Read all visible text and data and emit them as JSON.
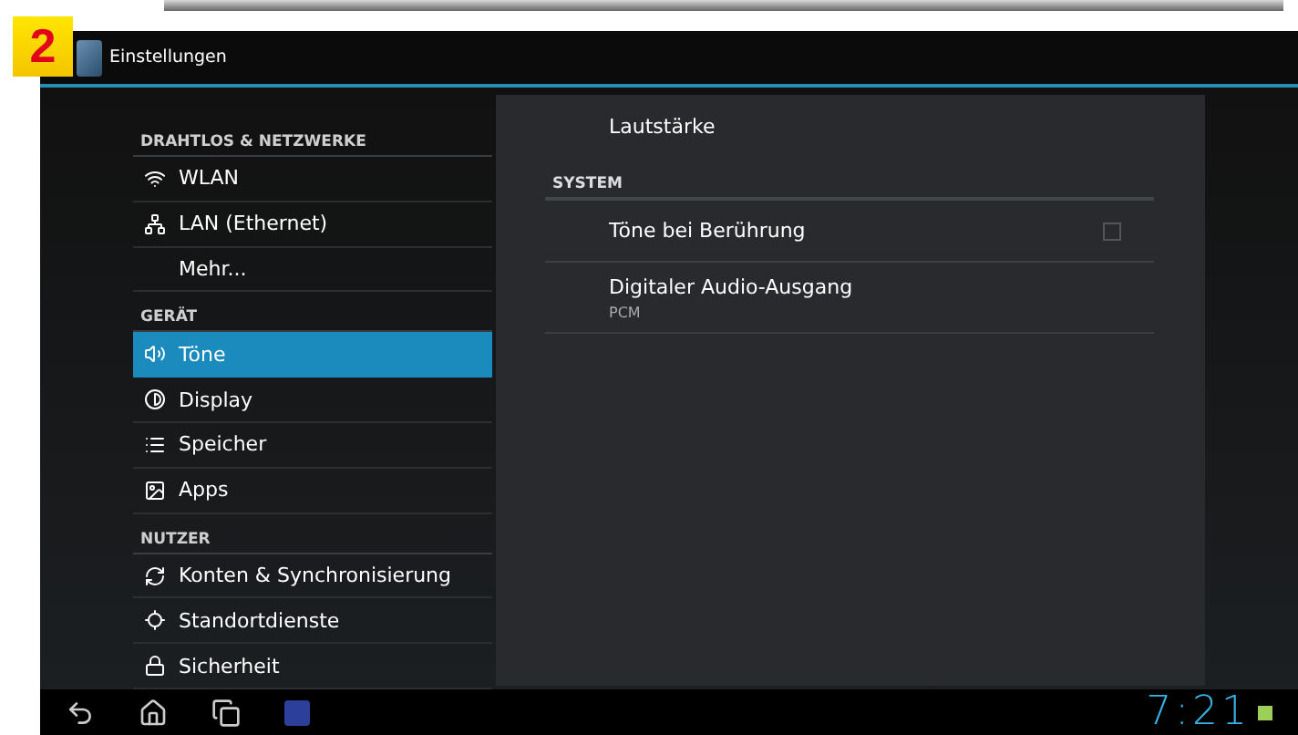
{
  "badge": "2",
  "window": {
    "title": "Einstellungen"
  },
  "sidebar": {
    "sections": [
      {
        "header": "DRAHTLOS & NETZWERKE",
        "items": [
          {
            "label": "WLAN",
            "kind": "wifi",
            "selected": false
          },
          {
            "label": "LAN (Ethernet)",
            "kind": "lan",
            "selected": false
          },
          {
            "label": "Mehr...",
            "kind": "more",
            "selected": false
          }
        ]
      },
      {
        "header": "GERÄT",
        "items": [
          {
            "label": "Töne",
            "kind": "sound",
            "selected": true
          },
          {
            "label": "Display",
            "kind": "display",
            "selected": false
          },
          {
            "label": "Speicher",
            "kind": "storage",
            "selected": false
          },
          {
            "label": "Apps",
            "kind": "apps",
            "selected": false
          }
        ]
      },
      {
        "header": "NUTZER",
        "items": [
          {
            "label": "Konten & Synchronisierung",
            "kind": "sync",
            "selected": false
          },
          {
            "label": "Standortdienste",
            "kind": "location",
            "selected": false
          },
          {
            "label": "Sicherheit",
            "kind": "security",
            "selected": false
          }
        ]
      }
    ]
  },
  "panel": {
    "rows": [
      {
        "kind": "plain",
        "title": "Lautstärke"
      },
      {
        "kind": "header",
        "title": "SYSTEM"
      },
      {
        "kind": "checkbox",
        "title": "Töne bei Berührung",
        "checked": false
      },
      {
        "kind": "summary",
        "title": "Digitaler Audio-Ausgang",
        "summary": "PCM"
      }
    ]
  },
  "status_bar": {
    "clock": "7:21"
  }
}
